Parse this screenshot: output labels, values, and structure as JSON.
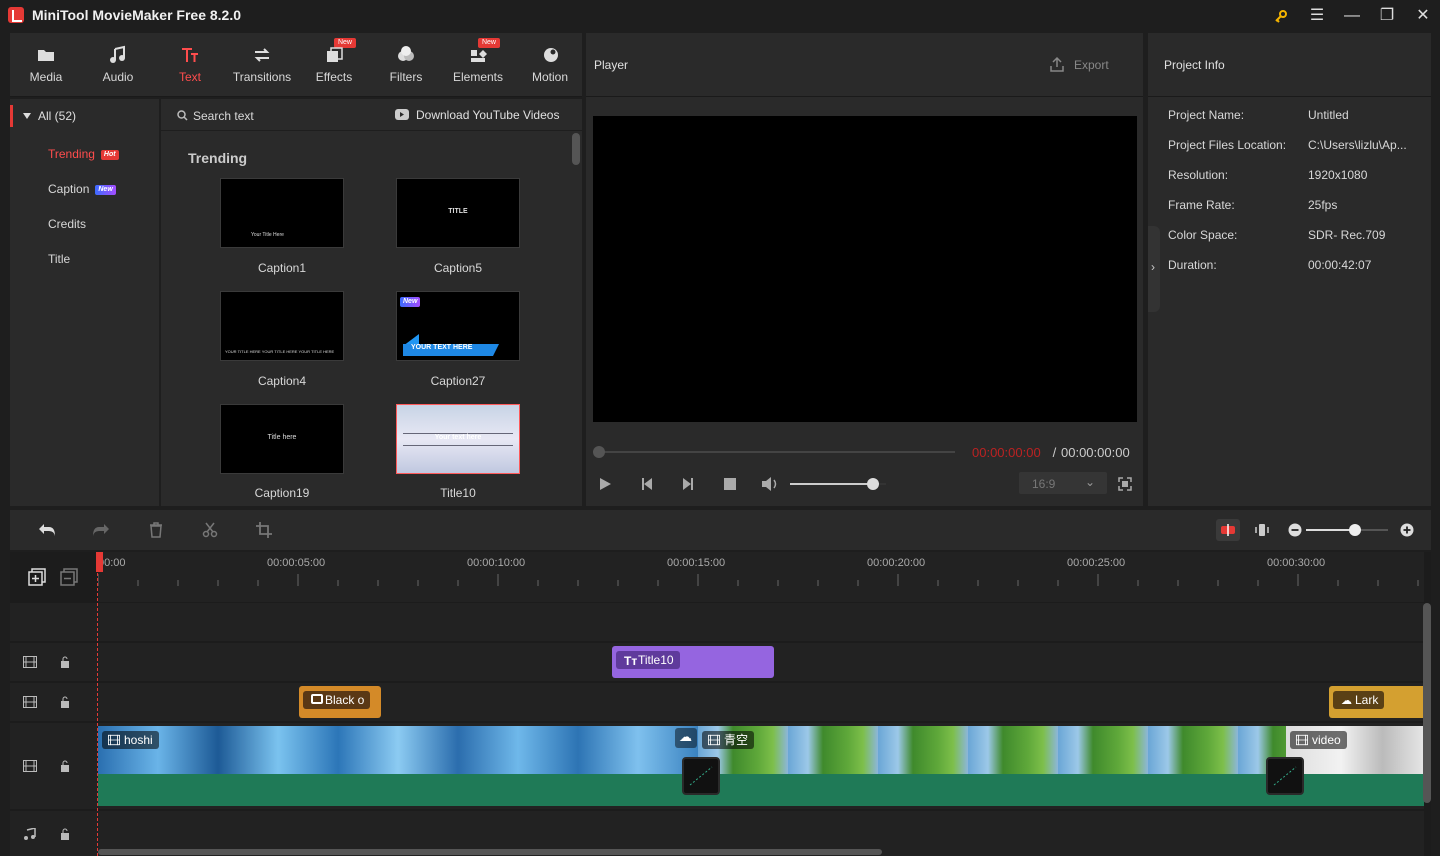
{
  "app": {
    "title": "MiniTool MovieMaker Free 8.2.0"
  },
  "tabs": [
    {
      "label": "Media",
      "icon": "folder-icon",
      "badge": ""
    },
    {
      "label": "Audio",
      "icon": "music-note-icon",
      "badge": ""
    },
    {
      "label": "Text",
      "icon": "text-icon",
      "badge": "",
      "active": true
    },
    {
      "label": "Transitions",
      "icon": "transitions-icon",
      "badge": ""
    },
    {
      "label": "Effects",
      "icon": "effects-icon",
      "badge": "New"
    },
    {
      "label": "Filters",
      "icon": "filters-icon",
      "badge": ""
    },
    {
      "label": "Elements",
      "icon": "elements-icon",
      "badge": "New"
    },
    {
      "label": "Motion",
      "icon": "motion-icon",
      "badge": ""
    }
  ],
  "sidebar": {
    "all": "All (52)",
    "items": [
      {
        "label": "Trending",
        "badge": "Hot"
      },
      {
        "label": "Caption",
        "badge": "New"
      },
      {
        "label": "Credits",
        "badge": ""
      },
      {
        "label": "Title",
        "badge": ""
      }
    ]
  },
  "content": {
    "search_placeholder": "Search text",
    "download": "Download YouTube Videos",
    "section": "Trending",
    "items": [
      {
        "label": "Caption1",
        "preview": "Your Title Here"
      },
      {
        "label": "Caption5",
        "preview": "TITLE"
      },
      {
        "label": "Caption4",
        "preview": "YOUR TITLE HERE YOUR TITLE HERE YOUR TITLE HERE"
      },
      {
        "label": "Caption27",
        "preview": "YOUR TEXT HERE",
        "badge": "New"
      },
      {
        "label": "Caption19",
        "preview": "Title here"
      },
      {
        "label": "Title10",
        "preview": "Your text here"
      }
    ]
  },
  "player": {
    "title": "Player",
    "export": "Export",
    "time_current": "00:00:00:00",
    "time_sep": " / ",
    "time_total": "00:00:00:00",
    "aspect": "16:9",
    "volume": 0.86
  },
  "project": {
    "title": "Project Info",
    "rows": [
      {
        "k": "Project Name:",
        "v": "Untitled"
      },
      {
        "k": "Project Files Location:",
        "v": "C:\\Users\\lizlu\\Ap..."
      },
      {
        "k": "Resolution:",
        "v": "1920x1080"
      },
      {
        "k": "Frame Rate:",
        "v": "25fps"
      },
      {
        "k": "Color Space:",
        "v": "SDR- Rec.709"
      },
      {
        "k": "Duration:",
        "v": "00:00:42:07"
      }
    ]
  },
  "timeline": {
    "ticks": [
      "00:00",
      "00:00:05:00",
      "00:00:10:00",
      "00:00:15:00",
      "00:00:20:00",
      "00:00:25:00",
      "00:00:30:00"
    ],
    "clips": {
      "title": "Title10",
      "element1": "Black o",
      "element2": "Lark",
      "video1": "hoshi",
      "video2": "青空",
      "video3": "video"
    },
    "zoom": 0.6
  }
}
